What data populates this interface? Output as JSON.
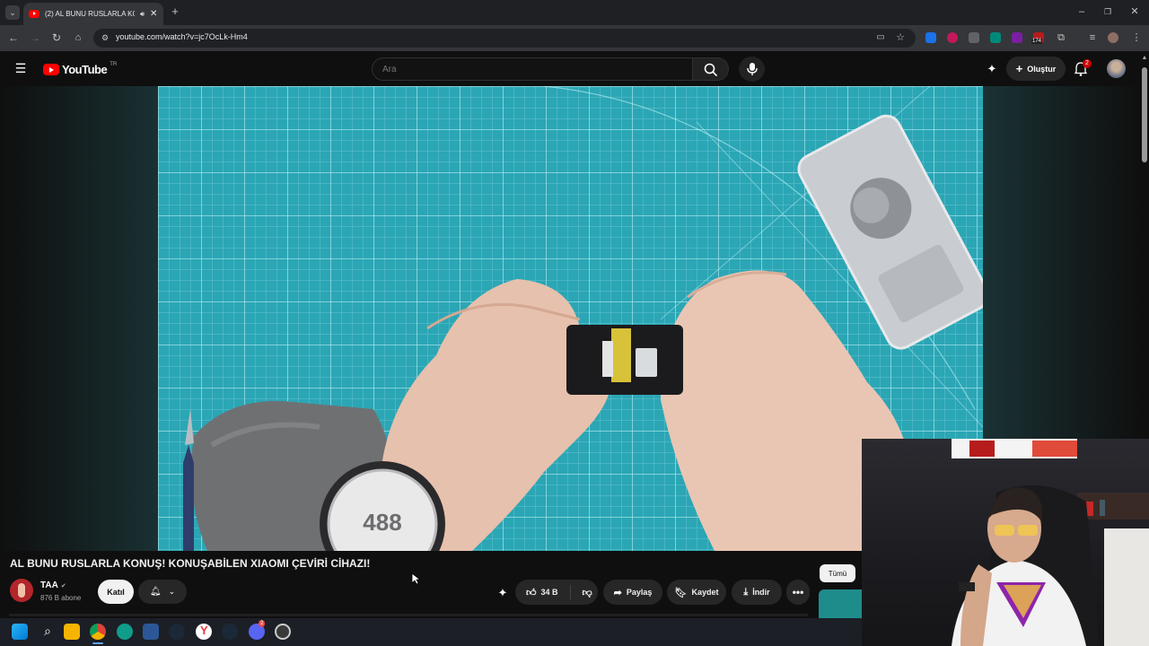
{
  "browser": {
    "tab_title": "(2) AL BUNU RUSLARLA KO",
    "url": "youtube.com/watch?v=jc7OcLk-Hm4",
    "extension_badge": "174"
  },
  "youtube": {
    "logo_text": "YouTube",
    "region": "TR",
    "search_placeholder": "Ara",
    "create_label": "Oluştur",
    "notification_count": "2"
  },
  "video": {
    "title": "AL BUNU RUSLARLA KONUŞ! KONUŞABİLEN XIAOMI ÇEVİRİ CİHAZI!",
    "channel": "TAA",
    "subscribers": "876 B abone",
    "join_label": "Katıl",
    "likes": "34 B",
    "share_label": "Paylaş",
    "save_label": "Kaydet",
    "download_label": "İndir",
    "filter_chip": "Tümü",
    "overlay_text": "488"
  },
  "taskbar": {
    "discord_badge": "2"
  },
  "colors": {
    "yt_red": "#ff0000",
    "mat_teal": "#2ba6b5",
    "bg": "#0f0f0f",
    "chip_bg": "#272727"
  }
}
